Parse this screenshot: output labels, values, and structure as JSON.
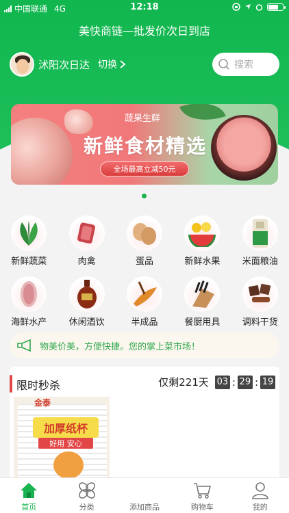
{
  "status_bar": {
    "carrier": "中国联通",
    "network": "4G",
    "time": "12:18"
  },
  "app": {
    "title": "美快商链—批发价次日到店"
  },
  "store": {
    "name": "沭阳次日达",
    "switch_label": "切换"
  },
  "search": {
    "placeholder": "搜索"
  },
  "banner": {
    "subtitle": "蔬果生鲜",
    "headline": "新鲜食材精选",
    "promo": "全场最高立减50元"
  },
  "categories": [
    {
      "label": "新鲜蔬菜",
      "icon": "vegetable-icon"
    },
    {
      "label": "肉禽",
      "icon": "meat-icon"
    },
    {
      "label": "蛋品",
      "icon": "egg-icon"
    },
    {
      "label": "新鲜水果",
      "icon": "fruit-icon"
    },
    {
      "label": "米面粮油",
      "icon": "rice-icon"
    },
    {
      "label": "海鲜水产",
      "icon": "seafood-icon"
    },
    {
      "label": "休闲酒饮",
      "icon": "liquor-icon"
    },
    {
      "label": "半成品",
      "icon": "semi-finished-icon"
    },
    {
      "label": "餐厨用具",
      "icon": "knife-set-icon"
    },
    {
      "label": "调料干货",
      "icon": "seasoning-icon"
    }
  ],
  "notice": {
    "text": "物美价美，方便快捷。您的掌上菜市场！"
  },
  "flash_sale": {
    "title": "限时秒杀",
    "remaining_label": "仅剩221天",
    "hours": "03",
    "minutes": "29",
    "seconds": "19",
    "product": {
      "top_text": "金泰",
      "tag": "加厚纸杯",
      "sub_tag": "好用 安心"
    }
  },
  "tabs": [
    {
      "label": "首页",
      "active": true
    },
    {
      "label": "分类",
      "active": false
    },
    {
      "label": "添加商品",
      "active": false
    },
    {
      "label": "购物车",
      "active": false
    },
    {
      "label": "我的",
      "active": false
    }
  ],
  "colors": {
    "brand_green": "#19b350",
    "accent_red": "#e24646"
  }
}
